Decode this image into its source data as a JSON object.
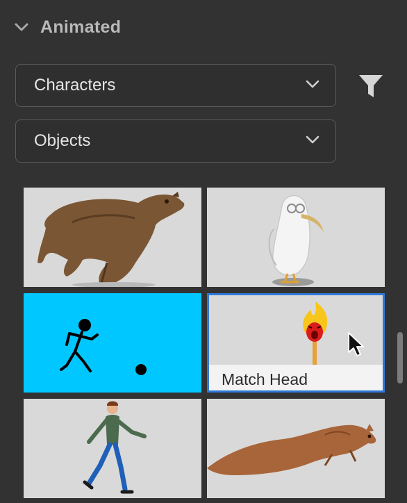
{
  "panel": {
    "section_title": "Animated",
    "section_expanded": true
  },
  "filters": {
    "dropdown1_value": "Characters",
    "dropdown2_value": "Objects",
    "filter_icon": "filter-icon"
  },
  "tiles": [
    {
      "subject": "bear",
      "label": ""
    },
    {
      "subject": "seagull",
      "label": ""
    },
    {
      "subject": "stick-figure-kicking-ball",
      "label": ""
    },
    {
      "subject": "match-head",
      "label": "Match Head",
      "selected": true
    },
    {
      "subject": "walking-man",
      "label": ""
    },
    {
      "subject": "squirrel",
      "label": ""
    }
  ],
  "colors": {
    "background": "#323232",
    "selection": "#2f79d8",
    "stick_tile_bg": "#00c7ff"
  }
}
